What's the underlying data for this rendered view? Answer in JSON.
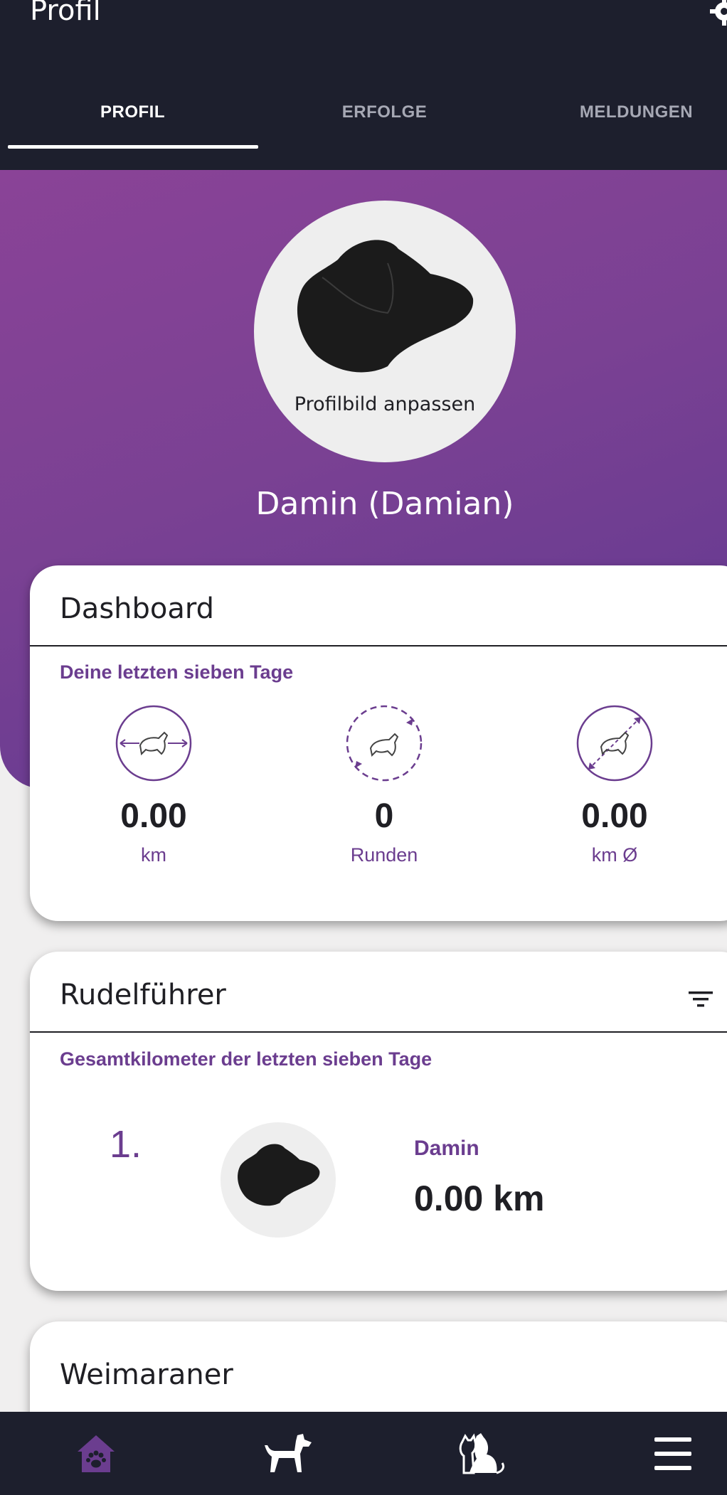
{
  "appbar": {
    "title": "Profil"
  },
  "tabs": [
    {
      "label": "PROFIL",
      "active": true
    },
    {
      "label": "ERFOLGE",
      "active": false
    },
    {
      "label": "MELDUNGEN",
      "active": false
    }
  ],
  "profile": {
    "avatar_caption": "Profilbild anpassen",
    "name": "Damin (Damian)"
  },
  "dashboard": {
    "title": "Dashboard",
    "subtitle": "Deine letzten sieben Tage",
    "stats": [
      {
        "icon": "dog-distance-icon",
        "value": "0.00",
        "label": "km"
      },
      {
        "icon": "dog-rounds-icon",
        "value": "0",
        "label": "Runden"
      },
      {
        "icon": "dog-average-icon",
        "value": "0.00",
        "label": "km Ø"
      }
    ]
  },
  "leaderboard": {
    "title": "Rudelführer",
    "subtitle": "Gesamtkilometer der letzten sieben Tage",
    "entries": [
      {
        "rank": "1.",
        "name": "Damin",
        "km": "0.00 km"
      }
    ]
  },
  "breed_card": {
    "title": "Weimaraner"
  },
  "bottom_nav": [
    {
      "icon": "home-paw-icon",
      "active": true
    },
    {
      "icon": "dog-icon",
      "active": false
    },
    {
      "icon": "dog-cat-icon",
      "active": false
    },
    {
      "icon": "menu-icon",
      "active": false
    }
  ],
  "colors": {
    "appbar": "#1d1f2d",
    "accent": "#6b3d8f",
    "hero_gradient_start": "#8a4397",
    "hero_gradient_end": "#5f3891",
    "text": "#1f1f24"
  }
}
